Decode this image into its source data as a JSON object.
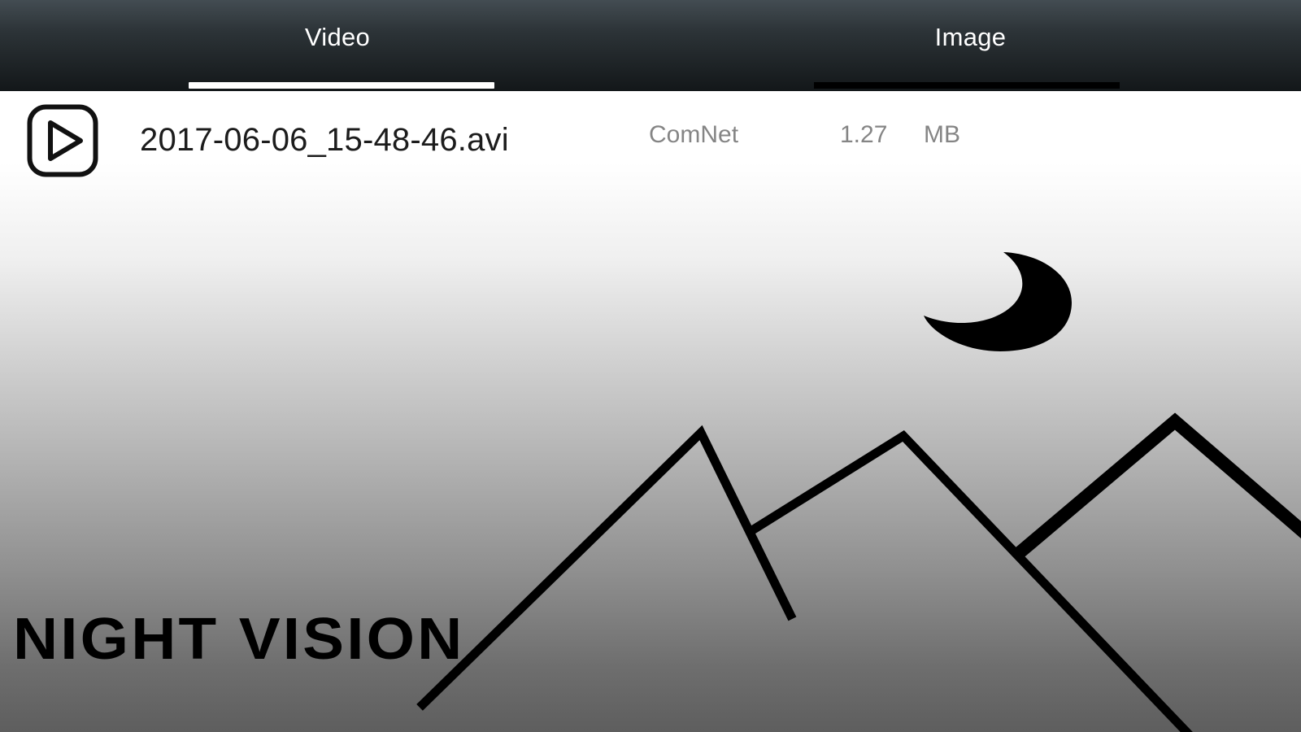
{
  "tabs": [
    {
      "label": "Video",
      "selected": true
    },
    {
      "label": "Image",
      "selected": false
    }
  ],
  "files": [
    {
      "icon": "play-icon",
      "name": "2017-06-06_15-48-46.avi",
      "source": "ComNet",
      "size": "1.27",
      "unit": "MB"
    }
  ],
  "background": {
    "brand_text": "NIGHT VISION",
    "moon_icon": "crescent-moon-icon",
    "mountains_icon": "mountains-icon"
  },
  "colors": {
    "tab_bar_top": "#434c52",
    "tab_bar_bottom": "#131719",
    "tab_indicator_active": "#ffffff",
    "tab_indicator_inactive": "#000000",
    "text_primary": "#1c1c1c",
    "text_secondary": "#858585"
  }
}
